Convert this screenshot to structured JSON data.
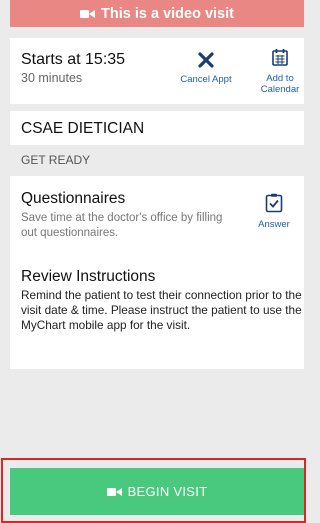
{
  "banner": {
    "icon": "video-camera-icon",
    "text": "This is a video visit"
  },
  "appointment": {
    "starts": "Starts at 15:35",
    "duration": "30 minutes",
    "cancel_label": "Cancel Appt",
    "add_calendar_label_line1": "Add to",
    "add_calendar_label_line2": "Calendar"
  },
  "department": "CSAE DIETICIAN",
  "get_ready_header": "GET READY",
  "questionnaires": {
    "title": "Questionnaires",
    "description": "Save time at the doctor's office by filling out questionnaires.",
    "answer_label": "Answer"
  },
  "review": {
    "title": "Review Instructions",
    "text": "Remind the patient to test their connection prior to the visit date & time. Please instruct the patient to use the MyChart mobile app for the visit."
  },
  "begin_button": {
    "icon": "video-camera-icon",
    "label": "BEGIN VISIT"
  },
  "colors": {
    "banner": "#e88784",
    "accent": "#1f5fa8",
    "begin": "#49c97e",
    "highlight": "#e02424",
    "background": "#ebebeb"
  }
}
